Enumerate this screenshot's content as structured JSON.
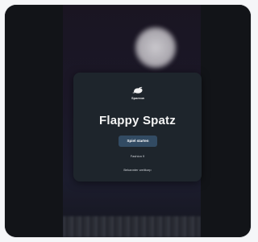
{
  "game": {
    "logo_text": "Sparrow",
    "logo_icon": "sparrow-bird-icon",
    "title": "Flappy Spatz",
    "start_button_label": "Spiel starten",
    "info_line_1": "Fashion 9",
    "info_line_2": "Bekannter weitkorp"
  },
  "colors": {
    "card_bg": "#1e252c",
    "button_bg": "#324b63",
    "page_bg": "#f5f6f8"
  }
}
